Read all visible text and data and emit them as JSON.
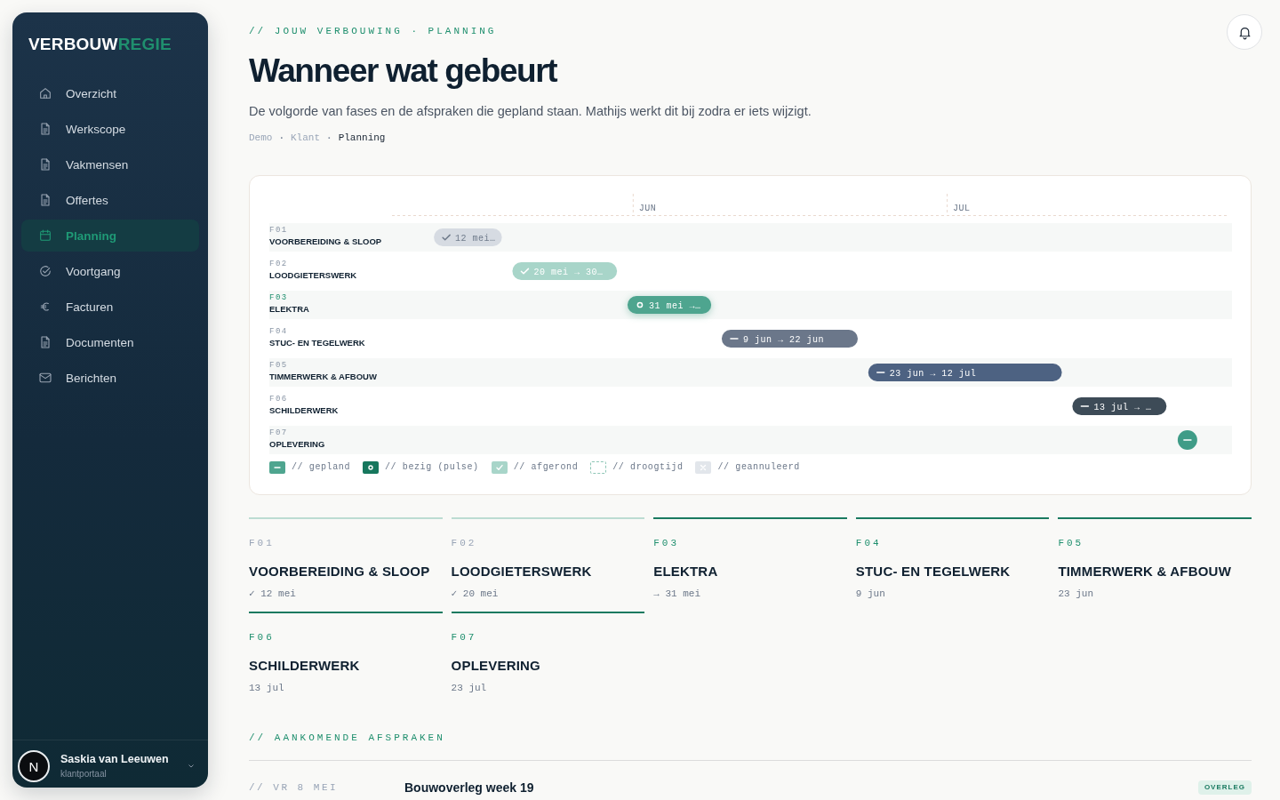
{
  "sidebar": {
    "logo": {
      "text": "VERBOUW",
      "accent_text": "REGIE"
    },
    "items": [
      {
        "label": "Overzicht",
        "selected": false
      },
      {
        "label": "Werkscope",
        "selected": false
      },
      {
        "label": "Vakmensen",
        "selected": false
      },
      {
        "label": "Offertes",
        "selected": false
      },
      {
        "label": "Planning",
        "selected": true
      },
      {
        "label": "Voortgang",
        "selected": false
      },
      {
        "label": "Facturen",
        "selected": false
      },
      {
        "label": "Documenten",
        "selected": false
      },
      {
        "label": "Berichten",
        "selected": false
      }
    ],
    "user": {
      "initial": "N",
      "name": "Saskia van Leeuwen",
      "role": "klantportaal"
    }
  },
  "header": {
    "eyebrow": "// JOUW VERBOUWING · PLANNING",
    "title": "Wanneer wat gebeurt",
    "subtitle": "De volgorde van fases en de afspraken die gepland staan. Mathijs werkt dit bij zodra er iets wijzigt.",
    "breadcrumb": [
      {
        "label": "Demo",
        "separator": "·",
        "current": false
      },
      {
        "label": "Klant",
        "separator": "·",
        "current": false
      },
      {
        "label": "Planning",
        "current": true
      }
    ]
  },
  "planning_timeline": {
    "months": [
      "JUN",
      "JUL"
    ],
    "rows": [
      {
        "code": "F01",
        "name": "VOORBEREIDING & SLOOP",
        "current": false,
        "bar": {
          "kind": "done",
          "label": "12 mei…",
          "color": "#d6dbe2"
        }
      },
      {
        "code": "F02",
        "name": "LOODGIETERSWERK",
        "current": false,
        "bar": {
          "kind": "done",
          "label": "20 mei → 30…",
          "color": "#a8d5c9"
        }
      },
      {
        "code": "F03",
        "name": "ELEKTRA",
        "current": true,
        "bar": {
          "kind": "active",
          "label": "31 mei →…",
          "color": "#4ea58f"
        }
      },
      {
        "code": "F04",
        "name": "STUC- EN TEGELWERK",
        "current": false,
        "bar": {
          "kind": "planned",
          "label": "9 jun → 22 jun",
          "color": "#6b778a"
        }
      },
      {
        "code": "F05",
        "name": "TIMMERWERK & AFBOUW",
        "current": false,
        "bar": {
          "kind": "planned",
          "label": "23 jun → 12 jul",
          "color": "#4d6282"
        }
      },
      {
        "code": "F06",
        "name": "SCHILDERWERK",
        "current": false,
        "bar": {
          "kind": "planned",
          "label": "13 jul → …",
          "color": "#3d4b57"
        }
      },
      {
        "code": "F07",
        "name": "OPLEVERING",
        "current": false,
        "bar": {
          "kind": "milestone",
          "color": "#3f9c87"
        }
      }
    ],
    "legend": [
      {
        "kind": "planned",
        "label": "// gepland",
        "color": "#4ea58f"
      },
      {
        "kind": "active",
        "label": "// bezig (pulse)",
        "color": "#16775d"
      },
      {
        "kind": "done",
        "label": "// afgerond",
        "color": "#a8d5c9"
      },
      {
        "kind": "drying",
        "label": "// droogtijd",
        "color": "#8fc7b7"
      },
      {
        "kind": "cancelled",
        "label": "// geannuleerd",
        "color": "#e2e6eb"
      }
    ]
  },
  "phases": [
    {
      "code": "F01",
      "name": "VOORBEREIDING & SLOOP",
      "date": "✓ 12 mei",
      "done": true
    },
    {
      "code": "F02",
      "name": "LOODGIETERSWERK",
      "date": "✓ 20 mei",
      "done": true
    },
    {
      "code": "F03",
      "name": "ELEKTRA",
      "date": "→ 31 mei",
      "done": false
    },
    {
      "code": "F04",
      "name": "STUC- EN TEGELWERK",
      "date": "9 jun",
      "done": false
    },
    {
      "code": "F05",
      "name": "TIMMERWERK & AFBOUW",
      "date": "23 jun",
      "done": false
    },
    {
      "code": "F06",
      "name": "SCHILDERWERK",
      "date": "13 jul",
      "done": false
    },
    {
      "code": "F07",
      "name": "OPLEVERING",
      "date": "23 jul",
      "done": false
    }
  ],
  "appointments": {
    "heading": "// AANKOMENDE AFSPRAKEN",
    "items": [
      {
        "date": "// VR 8 MEI",
        "title": "Bouwoverleg week 19",
        "tag": "OVERLEG"
      }
    ]
  }
}
